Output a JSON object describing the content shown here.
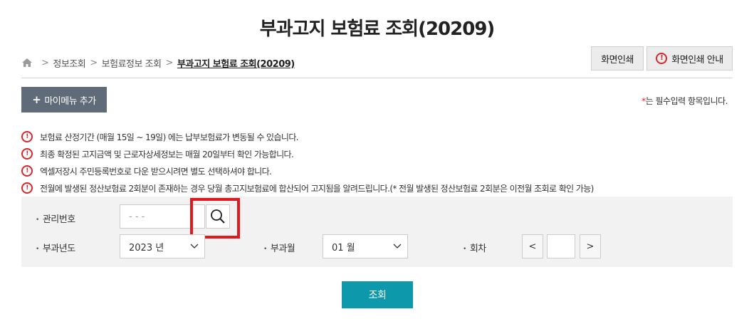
{
  "page": {
    "title": "부과고지 보험료 조회(20209)"
  },
  "breadcrumb": {
    "items": [
      "정보조회",
      "보험료정보 조회"
    ],
    "current": "부과고지 보험료 조회(20209)",
    "separator": ">"
  },
  "toolbar": {
    "print_label": "화면인쇄",
    "print_guide_label": "화면인쇄 안내"
  },
  "actions": {
    "add_mymenu_label": "마이메뉴 추가",
    "add_mymenu_icon": "+"
  },
  "required_note": {
    "star": "*",
    "text": "는 필수입력 항목입니다."
  },
  "notices": [
    "보험료 산정기간 (매월 15일 ~ 19일) 에는 납부보험료가 변동될 수 있습니다.",
    "최종 확정된 고지금액 및 근로자상세정보는 매월 20일부터 확인 가능합니다.",
    "엑셀저장시 주민등록번호로 다운 받으시려면 별도 선택하셔야 합니다.",
    "전월에 발생된 정산보험료 2회분이 존재하는 경우 당월 총고지보험료에 합산되어 고지됨을 알려드립니다.(* 전월 발생된 정산보험료 2회분은 이전월 조회로 확인 가능)"
  ],
  "form": {
    "management_number": {
      "label": "관리번호",
      "placeholder": "-  -   -"
    },
    "year": {
      "label": "부과년도",
      "value": "2023 년"
    },
    "month": {
      "label": "부과월",
      "value": "01 월"
    },
    "count": {
      "label": "회차",
      "prev": "<",
      "next": ">",
      "value": ""
    }
  },
  "submit": {
    "label": "조회"
  },
  "icons": {
    "home": "home-icon",
    "alert": "alert-circle-icon",
    "search": "search-icon",
    "chevron": "chevron-down-icon"
  },
  "colors": {
    "accent_red": "#d9262b",
    "submit_bg": "#0e98ac",
    "mymenu_bg": "#5f6b78",
    "highlight": "#e0191f"
  }
}
